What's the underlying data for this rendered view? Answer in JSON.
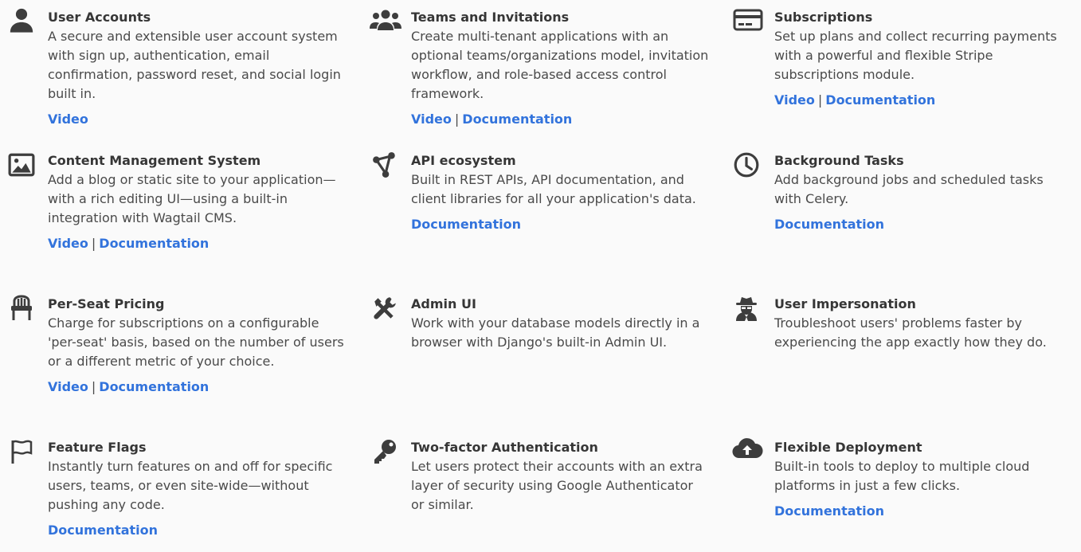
{
  "features": [
    {
      "title": "User Accounts",
      "icon": "user-icon",
      "description": "A secure and extensible user account system with sign up, authentication, email confirmation, password reset, and social login built in.",
      "links": [
        "Video"
      ]
    },
    {
      "title": "Teams and Invitations",
      "icon": "users-icon",
      "description": "Create multi-tenant applications with an optional teams/organizations model, invitation workflow, and role-based access control framework.",
      "links": [
        "Video",
        "Documentation"
      ]
    },
    {
      "title": "Subscriptions",
      "icon": "credit-card-icon",
      "description": "Set up plans and collect recurring payments with a powerful and flexible Stripe subscriptions module.",
      "links": [
        "Video",
        "Documentation"
      ]
    },
    {
      "title": "Content Management System",
      "icon": "image-icon",
      "description": "Add a blog or static site to your application—with a rich editing UI—using a built-in integration with Wagtail CMS.",
      "links": [
        "Video",
        "Documentation"
      ]
    },
    {
      "title": "API ecosystem",
      "icon": "connection-icon",
      "description": "Built in REST APIs, API documentation, and client libraries for all your application's data.",
      "links": [
        "Documentation"
      ]
    },
    {
      "title": "Background Tasks",
      "icon": "clock-icon",
      "description": "Add background jobs and scheduled tasks with Celery.",
      "links": [
        "Documentation"
      ]
    },
    {
      "title": "Per-Seat Pricing",
      "icon": "chair-icon",
      "description": "Charge for subscriptions on a configurable 'per-seat' basis, based on the number of users or a different metric of your choice.",
      "links": [
        "Video",
        "Documentation"
      ]
    },
    {
      "title": "Admin UI",
      "icon": "tools-icon",
      "description": "Work with your database models directly in a browser with Django's built-in Admin UI.",
      "links": []
    },
    {
      "title": "User Impersonation",
      "icon": "spy-icon",
      "description": "Troubleshoot users' problems faster by experiencing the app exactly how they do.",
      "links": []
    },
    {
      "title": "Feature Flags",
      "icon": "flag-icon",
      "description": "Instantly turn features on and off for specific users, teams, or even site-wide—without pushing any code.",
      "links": [
        "Documentation"
      ]
    },
    {
      "title": "Two-factor Authentication",
      "icon": "key-icon",
      "description": "Let users protect their accounts with an extra layer of security using Google Authenticator or similar.",
      "links": []
    },
    {
      "title": "Flexible Deployment",
      "icon": "cloud-upload-icon",
      "description": "Built-in tools to deploy to multiple cloud platforms in just a few clicks.",
      "links": [
        "Documentation"
      ]
    }
  ],
  "separator": "|",
  "colors": {
    "link": "#3273dc",
    "icon": "#3d3d3d",
    "background": "#fafafa"
  }
}
